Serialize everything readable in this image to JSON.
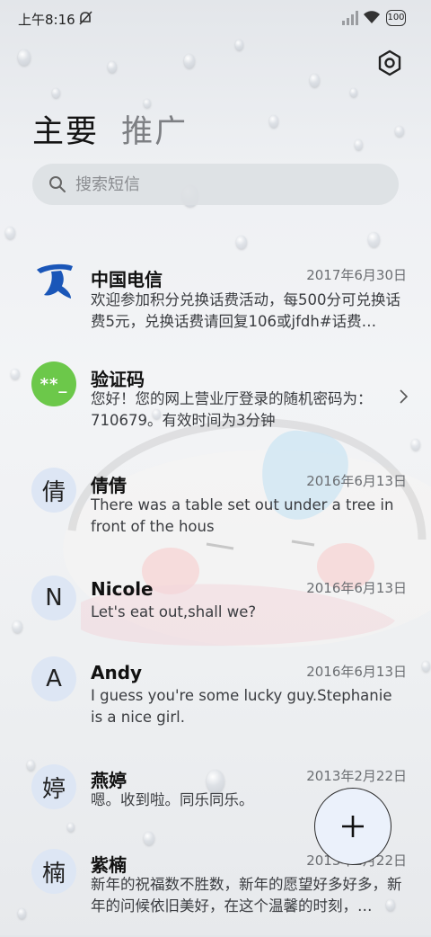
{
  "status_bar": {
    "time": "上午8:16",
    "battery": "100"
  },
  "tabs": [
    {
      "label": "主要",
      "active": true
    },
    {
      "label": "推广",
      "active": false
    }
  ],
  "search": {
    "placeholder": "搜索短信"
  },
  "conversations": [
    {
      "avatar_type": "logo",
      "avatar_text": "",
      "avatar_icon": "china-telecom-logo-icon",
      "name": "中国电信",
      "date": "2017年6月30日",
      "preview": "欢迎参加积分兑换话费活动，每500分可兑换话费5元，兑换话费请回复106或jfdh#话费…"
    },
    {
      "avatar_type": "code",
      "avatar_text": "**_",
      "name": "验证码",
      "date": "",
      "preview": "您好！您的网上营业厅登录的随机密码为：710679。有效时间为3分钟"
    },
    {
      "avatar_type": "letter",
      "avatar_text": "倩",
      "name": "倩倩",
      "date": "2016年6月13日",
      "preview": "There was a table set out under a tree in front of the hous"
    },
    {
      "avatar_type": "letter",
      "avatar_text": "N",
      "name": "Nicole",
      "date": "2016年6月13日",
      "preview": "Let's eat out,shall we?"
    },
    {
      "avatar_type": "letter",
      "avatar_text": "A",
      "name": "Andy",
      "date": "2016年6月13日",
      "preview": "I guess you're some lucky guy.Stephanie is a nice girl."
    },
    {
      "avatar_type": "letter",
      "avatar_text": "婷",
      "name": "燕婷",
      "date": "2013年2月22日",
      "preview": "嗯。收到啦。同乐同乐。"
    },
    {
      "avatar_type": "letter",
      "avatar_text": "楠",
      "name": "紫楠",
      "date": "2013年2月22日",
      "preview": "新年的祝福数不胜数，新年的愿望好多好多，新年的问候依旧美好，在这个温馨的时刻，…"
    }
  ],
  "icons": {
    "settings": "gear-icon",
    "search": "search-icon",
    "compose": "plus-icon",
    "chevron": "chevron-right-icon"
  },
  "colors": {
    "code_avatar_bg": "#6cc84a",
    "letter_avatar_bg": "#dde6f4",
    "telecom_blue": "#1a56b8",
    "fab_bg": "#ebf1fb"
  }
}
